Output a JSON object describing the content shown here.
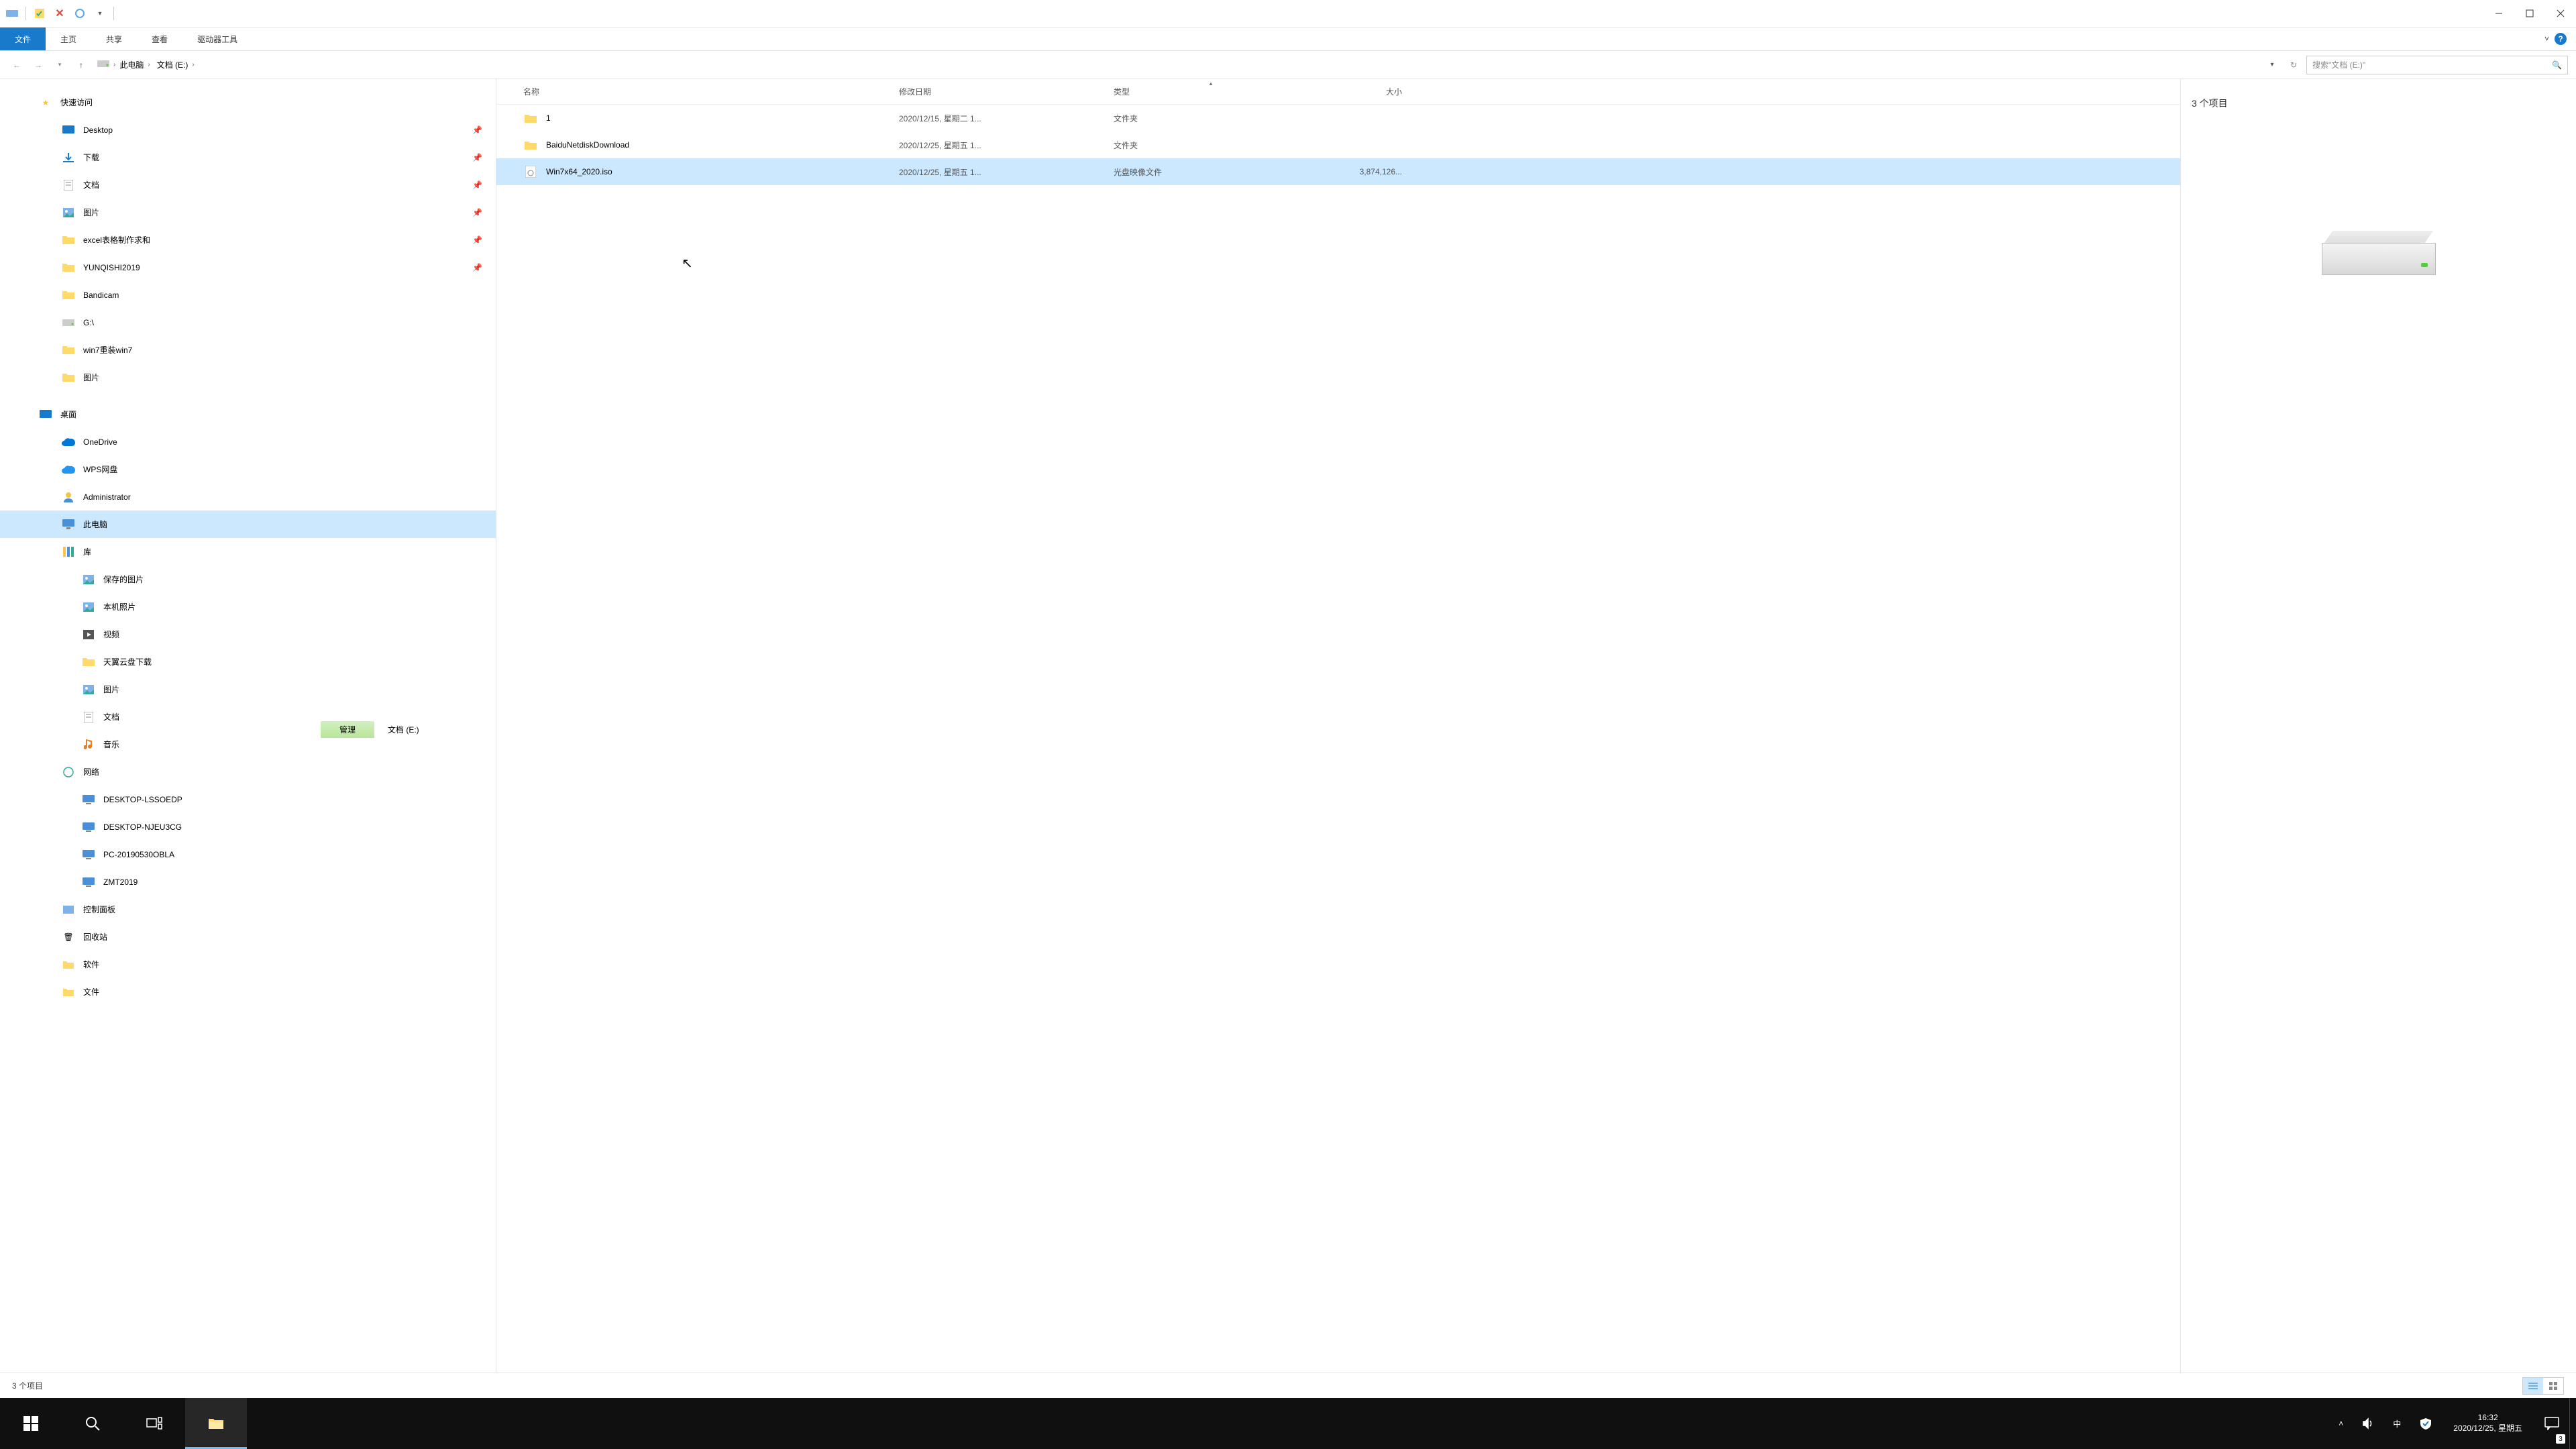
{
  "titlebar": {
    "context_tab": "管理",
    "window_title": "文档 (E:)"
  },
  "ribbon": {
    "file": "文件",
    "tabs": [
      "主页",
      "共享",
      "查看",
      "驱动器工具"
    ],
    "expand_hint": "˅"
  },
  "nav": {
    "breadcrumb": [
      "此电脑",
      "文档 (E:)"
    ],
    "refresh": "↻",
    "search_placeholder": "搜索\"文档 (E:)\""
  },
  "tree": {
    "quick_access": "快速访问",
    "quick_items": [
      {
        "label": "Desktop",
        "icon": "desktop",
        "pinned": true
      },
      {
        "label": "下载",
        "icon": "downloads",
        "pinned": true
      },
      {
        "label": "文档",
        "icon": "documents",
        "pinned": true
      },
      {
        "label": "图片",
        "icon": "pictures",
        "pinned": true
      },
      {
        "label": "excel表格制作求和",
        "icon": "folder",
        "pinned": true
      },
      {
        "label": "YUNQISHI2019",
        "icon": "folder",
        "pinned": true
      },
      {
        "label": "Bandicam",
        "icon": "folder",
        "pinned": false
      },
      {
        "label": "G:\\",
        "icon": "drive",
        "pinned": false
      },
      {
        "label": "win7重装win7",
        "icon": "folder",
        "pinned": false
      },
      {
        "label": "图片",
        "icon": "folder",
        "pinned": false
      }
    ],
    "desktop_root": "桌面",
    "desktop_items": [
      {
        "label": "OneDrive",
        "icon": "onedrive"
      },
      {
        "label": "WPS网盘",
        "icon": "wps"
      },
      {
        "label": "Administrator",
        "icon": "user"
      },
      {
        "label": "此电脑",
        "icon": "thispc",
        "selected": true
      },
      {
        "label": "库",
        "icon": "libraries"
      }
    ],
    "lib_items": [
      {
        "label": "保存的图片",
        "icon": "picture"
      },
      {
        "label": "本机照片",
        "icon": "picture"
      },
      {
        "label": "视频",
        "icon": "video"
      },
      {
        "label": "天翼云盘下载",
        "icon": "folder"
      },
      {
        "label": "图片",
        "icon": "picture"
      },
      {
        "label": "文档",
        "icon": "documents"
      },
      {
        "label": "音乐",
        "icon": "music"
      }
    ],
    "network": "网络",
    "network_items": [
      {
        "label": "DESKTOP-LSSOEDP"
      },
      {
        "label": "DESKTOP-NJEU3CG"
      },
      {
        "label": "PC-20190530OBLA"
      },
      {
        "label": "ZMT2019"
      }
    ],
    "control_panel": "控制面板",
    "recycle": "回收站",
    "software": "软件",
    "files": "文件"
  },
  "columns": {
    "name": "名称",
    "date": "修改日期",
    "type": "类型",
    "size": "大小"
  },
  "rows": [
    {
      "name": "1",
      "date": "2020/12/15, 星期二 1...",
      "type": "文件夹",
      "size": "",
      "icon": "folder"
    },
    {
      "name": "BaiduNetdiskDownload",
      "date": "2020/12/25, 星期五 1...",
      "type": "文件夹",
      "size": "",
      "icon": "folder"
    },
    {
      "name": "Win7x64_2020.iso",
      "date": "2020/12/25, 星期五 1...",
      "type": "光盘映像文件",
      "size": "3,874,126...",
      "icon": "iso",
      "selected": true
    }
  ],
  "preview": {
    "count_text": "3 个项目"
  },
  "statusbar": {
    "text": "3 个项目"
  },
  "taskbar": {
    "time": "16:32",
    "date": "2020/12/25, 星期五",
    "ime": "中",
    "notif_count": "3"
  }
}
